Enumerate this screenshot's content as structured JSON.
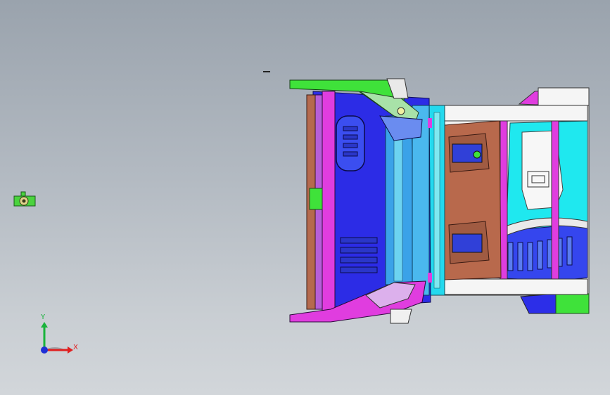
{
  "viewport": {
    "background_top": "#9aa3ad",
    "background_bottom": "#d2d6da"
  },
  "triad": {
    "x_label": "X",
    "y_label": "Y",
    "x_color": "#e02020",
    "y_color": "#19b33b",
    "z_color": "#1f2fd6"
  },
  "model": {
    "name_icon": "vehicle-floor-assembly",
    "colors": {
      "blue": "#2d2ee8",
      "magenta": "#e23ce0",
      "cyan": "#1ff0f0",
      "green": "#42e43a",
      "brown": "#b56a4e",
      "white": "#f4f4f4",
      "light_cyan": "#6fe9ef",
      "lilac": "#d9a0e6"
    }
  }
}
